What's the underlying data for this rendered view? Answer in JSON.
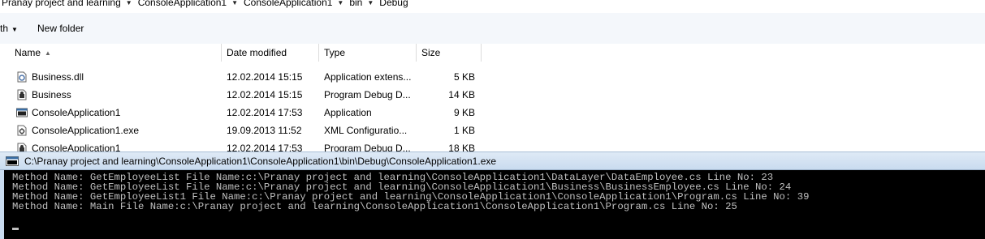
{
  "breadcrumb": [
    "Pranay project and learning",
    "ConsoleApplication1",
    "ConsoleApplication1",
    "bin",
    "Debug"
  ],
  "toolbar": {
    "partial_label": "th",
    "new_folder": "New folder"
  },
  "columns": {
    "name": "Name",
    "date": "Date modified",
    "type": "Type",
    "size": "Size"
  },
  "files": [
    {
      "name": "Business.dll",
      "date": "12.02.2014 15:15",
      "type": "Application extens...",
      "size": "5 KB",
      "icon": "dll-icon"
    },
    {
      "name": "Business",
      "date": "12.02.2014 15:15",
      "type": "Program Debug D...",
      "size": "14 KB",
      "icon": "pdb-icon"
    },
    {
      "name": "ConsoleApplication1",
      "date": "12.02.2014 17:53",
      "type": "Application",
      "size": "9 KB",
      "icon": "exe-icon"
    },
    {
      "name": "ConsoleApplication1.exe",
      "date": "19.09.2013 11:52",
      "type": "XML Configuratio...",
      "size": "1 KB",
      "icon": "config-icon"
    },
    {
      "name": "ConsoleApplication1",
      "date": "12.02.2014 17:53",
      "type": "Program Debug D...",
      "size": "18 KB",
      "icon": "pdb-icon"
    }
  ],
  "console": {
    "title": "C:\\Pranay project and learning\\ConsoleApplication1\\ConsoleApplication1\\bin\\Debug\\ConsoleApplication1.exe",
    "lines": [
      "Method Name: GetEmployeeList File Name:c:\\Pranay project and learning\\ConsoleApplication1\\DataLayer\\DataEmployee.cs Line No: 23",
      "Method Name: GetEmployeeList File Name:c:\\Pranay project and learning\\ConsoleApplication1\\Business\\BusinessEmployee.cs Line No: 24",
      "Method Name: GetEmployeeList1 File Name:c:\\Pranay project and learning\\ConsoleApplication1\\ConsoleApplication1\\Program.cs Line No: 39",
      "Method Name: Main File Name:c:\\Pranay project and learning\\ConsoleApplication1\\ConsoleApplication1\\Program.cs Line No: 25"
    ]
  }
}
